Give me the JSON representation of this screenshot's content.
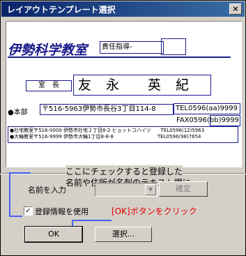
{
  "window": {
    "title": "レイアウトテンプレート選択",
    "close_glyph": "×"
  },
  "preview": {
    "school_name": "伊勢科学教室",
    "role_title": "責任指導-",
    "position": "室　長",
    "person_name": "友　永　　英　紀",
    "honbu_label": "●本部",
    "honbu_address": "〒516-5963伊勢市長谷3丁目114-8",
    "tel": "TEL0596(aa)9999",
    "fax": "FAX0596(bb)9999",
    "branch_line_1": "●社宅教室〒516-0000 伊勢市社宅２丁目8-2 ヒョットコハイツ　　TEL0596(12)5963",
    "branch_line_2": "●大輪教室〒516-9999 伊勢市大輪1丁目8-8-8　　　　　　　　　TEL0596(98)7654"
  },
  "form": {
    "name_input_label": "名前を入力",
    "confirm_button": "確定",
    "checkbox_label": "登録情報を使用",
    "checkbox_checked": true,
    "check_glyph": "✓",
    "ok_button": "OK",
    "select_button": "選択..."
  },
  "annotations": {
    "note_line_1": "ここにチェックすると登録した",
    "note_line_2": "名前や住所が名刺のテキスト欄に",
    "ok_note": "[OK]ボタンをクリック",
    "note_color": "#000000",
    "ok_note_color": "#e00000",
    "arrow_color": "#1a3cff"
  }
}
